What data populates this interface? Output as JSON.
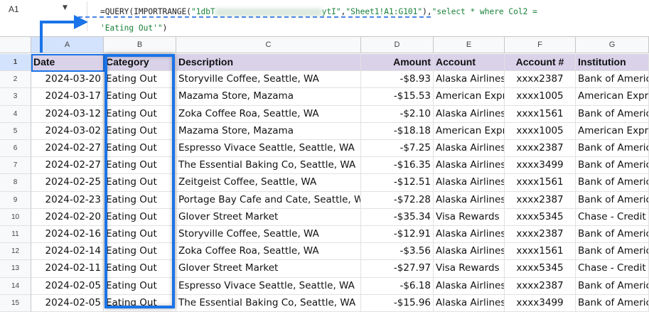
{
  "formula_bar": {
    "name_box": "A1",
    "formula_line1_start": "=QUERY(IMPORTRANGE(",
    "formula_key_start": "\"1dbT",
    "formula_key_end": "ytI\"",
    "formula_range": "\"Sheet1!A1:G101\"",
    "formula_select": "\"select * where Col2 =",
    "formula_line2_string": "'Eating Out'\"",
    "formula_line2_end": ")"
  },
  "columns": [
    "A",
    "B",
    "C",
    "D",
    "E",
    "F",
    "G"
  ],
  "selected_column": "A",
  "header_row": {
    "row_number": "1",
    "cells": [
      "Date",
      "Category",
      "Description",
      "Amount",
      "Account",
      "Account #",
      "Institution"
    ]
  },
  "rows": [
    {
      "n": "2",
      "cells": [
        "2024-03-20",
        "Eating Out",
        "Storyville Coffee, Seattle, WA",
        "-$8.93",
        "Alaska Airlines",
        "xxxx2387",
        "Bank of America"
      ]
    },
    {
      "n": "3",
      "cells": [
        "2024-03-17",
        "Eating Out",
        "Mazama Store, Mazama",
        "-$15.53",
        "American Express",
        "xxxx1005",
        "American Express"
      ]
    },
    {
      "n": "4",
      "cells": [
        "2024-03-12",
        "Eating Out",
        "Zoka Coffee Roa, Seattle, WA",
        "-$2.10",
        "Alaska Airlines",
        "xxxx1561",
        "Bank of America"
      ]
    },
    {
      "n": "5",
      "cells": [
        "2024-03-02",
        "Eating Out",
        "Mazama Store, Mazama",
        "-$18.18",
        "American Express",
        "xxxx1005",
        "American Express"
      ]
    },
    {
      "n": "6",
      "cells": [
        "2024-02-27",
        "Eating Out",
        "Espresso Vivace Seattle, Seattle, WA",
        "-$7.25",
        "Alaska Airlines",
        "xxxx2387",
        "Bank of America"
      ]
    },
    {
      "n": "7",
      "cells": [
        "2024-02-27",
        "Eating Out",
        "The Essential Baking Co, Seattle, WA",
        "-$16.35",
        "Alaska Airlines",
        "xxxx3499",
        "Bank of America"
      ]
    },
    {
      "n": "8",
      "cells": [
        "2024-02-25",
        "Eating Out",
        "Zeitgeist Coffee, Seattle, WA",
        "-$12.51",
        "Alaska Airlines",
        "xxxx1561",
        "Bank of America"
      ]
    },
    {
      "n": "9",
      "cells": [
        "2024-02-23",
        "Eating Out",
        "Portage Bay Cafe and Cate, Seattle, WA",
        "-$72.28",
        "Alaska Airlines",
        "xxxx2387",
        "Bank of America"
      ]
    },
    {
      "n": "10",
      "cells": [
        "2024-02-20",
        "Eating Out",
        "Glover Street Market",
        "-$35.34",
        "Visa Rewards",
        "xxxx5345",
        "Chase - Credit Card"
      ]
    },
    {
      "n": "11",
      "cells": [
        "2024-02-16",
        "Eating Out",
        "Storyville Coffee, Seattle, WA",
        "-$12.91",
        "Alaska Airlines",
        "xxxx2387",
        "Bank of America"
      ]
    },
    {
      "n": "12",
      "cells": [
        "2024-02-14",
        "Eating Out",
        "Zoka Coffee Roa, Seattle, WA",
        "-$3.56",
        "Alaska Airlines",
        "xxxx1561",
        "Bank of America"
      ]
    },
    {
      "n": "13",
      "cells": [
        "2024-02-11",
        "Eating Out",
        "Glover Street Market",
        "-$27.97",
        "Visa Rewards",
        "xxxx5345",
        "Chase - Credit Card"
      ]
    },
    {
      "n": "14",
      "cells": [
        "2024-02-05",
        "Eating Out",
        "Espresso Vivace Seattle, Seattle, WA",
        "-$6.18",
        "Alaska Airlines",
        "xxxx2387",
        "Bank of America"
      ]
    },
    {
      "n": "15",
      "cells": [
        "2024-02-05",
        "Eating Out",
        "The Essential Baking Co, Seattle, WA",
        "-$15.96",
        "Alaska Airlines",
        "xxxx3499",
        "Bank of America"
      ]
    }
  ],
  "colors": {
    "header_fill": "#d9d2e9",
    "highlight": "#1a73e8",
    "formula_string": "#188038"
  }
}
